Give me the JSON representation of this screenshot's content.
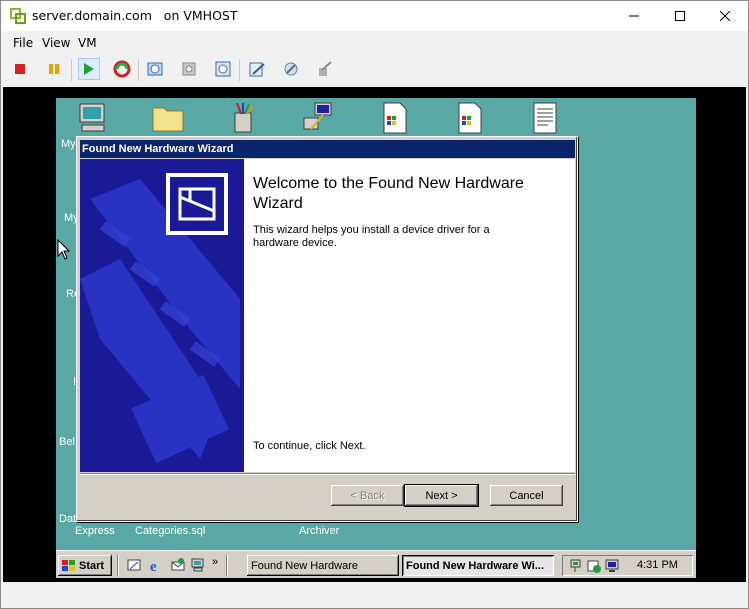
{
  "window": {
    "title": "server.domain.com   on VMHOST",
    "minimize_icon": "minimize-icon",
    "maximize_icon": "maximize-icon",
    "close_icon": "close-icon"
  },
  "menu": [
    "File",
    "View",
    "VM"
  ],
  "toolbar": {
    "buttons": [
      "stop-icon",
      "pause-icon",
      "start-icon",
      "reset-icon",
      "snapshot-icon",
      "revert-icon",
      "manage-snapshots-icon",
      "settings-icon",
      "tools-icon",
      "vm-options-icon"
    ]
  },
  "desktop": {
    "icon_labels": [
      "My",
      "My",
      "Re",
      "I",
      "Bel",
      "Dat",
      "Express",
      "Categories.sql",
      "Archiver"
    ]
  },
  "wizard": {
    "title": "Found New Hardware Wizard",
    "heading": "Welcome to the Found New Hardware Wizard",
    "description": "This wizard helps you install a device driver for a hardware device.",
    "continue_text": "To continue, click Next.",
    "back_label": "< Back",
    "next_label": "Next >",
    "cancel_label": "Cancel"
  },
  "taskbar": {
    "start_label": "Start",
    "quick_launch_more": "»",
    "tasks": [
      "Found New Hardware",
      "Found New Hardware Wi..."
    ],
    "clock": "4:31 PM"
  },
  "colors": {
    "desktop": "#5aa8a5",
    "titlebar_active": "#0a246a",
    "wizard_side": "#1c1c9a"
  }
}
